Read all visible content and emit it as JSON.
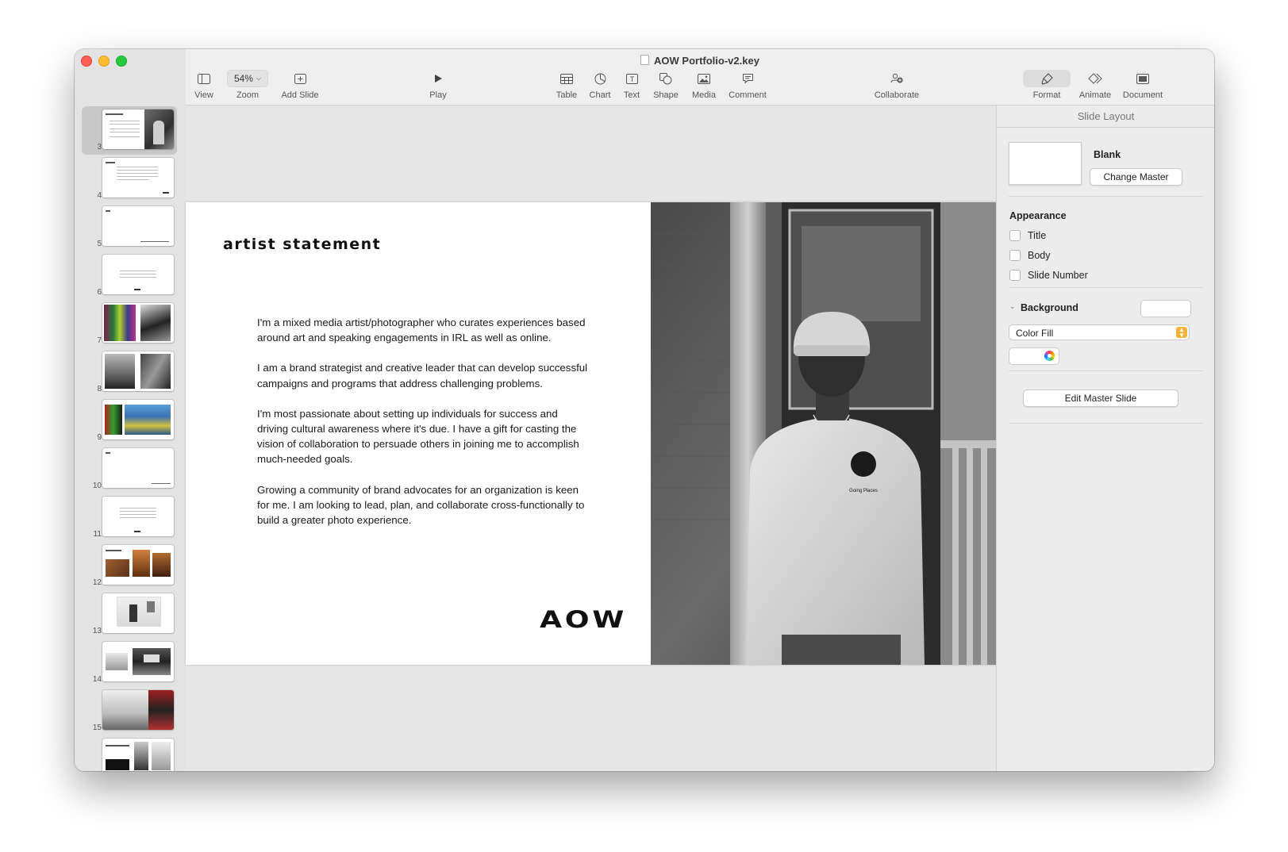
{
  "window": {
    "title": "AOW Portfolio-v2.key"
  },
  "toolbar": {
    "view": "View",
    "zoom_value": "54%",
    "zoom": "Zoom",
    "add_slide": "Add Slide",
    "play": "Play",
    "table": "Table",
    "chart": "Chart",
    "text": "Text",
    "shape": "Shape",
    "media": "Media",
    "comment": "Comment",
    "collaborate": "Collaborate",
    "format": "Format",
    "animate": "Animate",
    "document": "Document"
  },
  "navigator": {
    "slides": [
      {
        "num": "3",
        "selected": true
      },
      {
        "num": "4"
      },
      {
        "num": "5"
      },
      {
        "num": "6"
      },
      {
        "num": "7"
      },
      {
        "num": "8"
      },
      {
        "num": "9"
      },
      {
        "num": "10"
      },
      {
        "num": "11"
      },
      {
        "num": "12"
      },
      {
        "num": "13"
      },
      {
        "num": "14"
      },
      {
        "num": "15"
      },
      {
        "num": ""
      }
    ]
  },
  "slide": {
    "heading": "artist statement",
    "paragraphs": [
      "I'm a mixed media artist/photographer who curates experiences based around art and speaking engagements in IRL as well as online.",
      "I am a brand strategist and creative leader that can develop successful campaigns and programs that address challenging problems.",
      "I'm most passionate about setting up individuals for success and driving cultural awareness where it's due. I have a gift for casting the vision of collaboration to persuade others in joining me to accomplish much-needed goals.",
      "Growing a community of brand advocates for an organization is keen for me. I am looking to lead, plan, and collaborate cross-functionally to build a greater photo experience."
    ],
    "logo": "AOW",
    "photo_shirt_text": "Going Places"
  },
  "inspector": {
    "header": "Slide Layout",
    "master_name": "Blank",
    "change_master": "Change Master",
    "appearance_title": "Appearance",
    "checkboxes": [
      "Title",
      "Body",
      "Slide Number"
    ],
    "background_title": "Background",
    "fill_type": "Color Fill",
    "edit_master": "Edit Master Slide"
  }
}
